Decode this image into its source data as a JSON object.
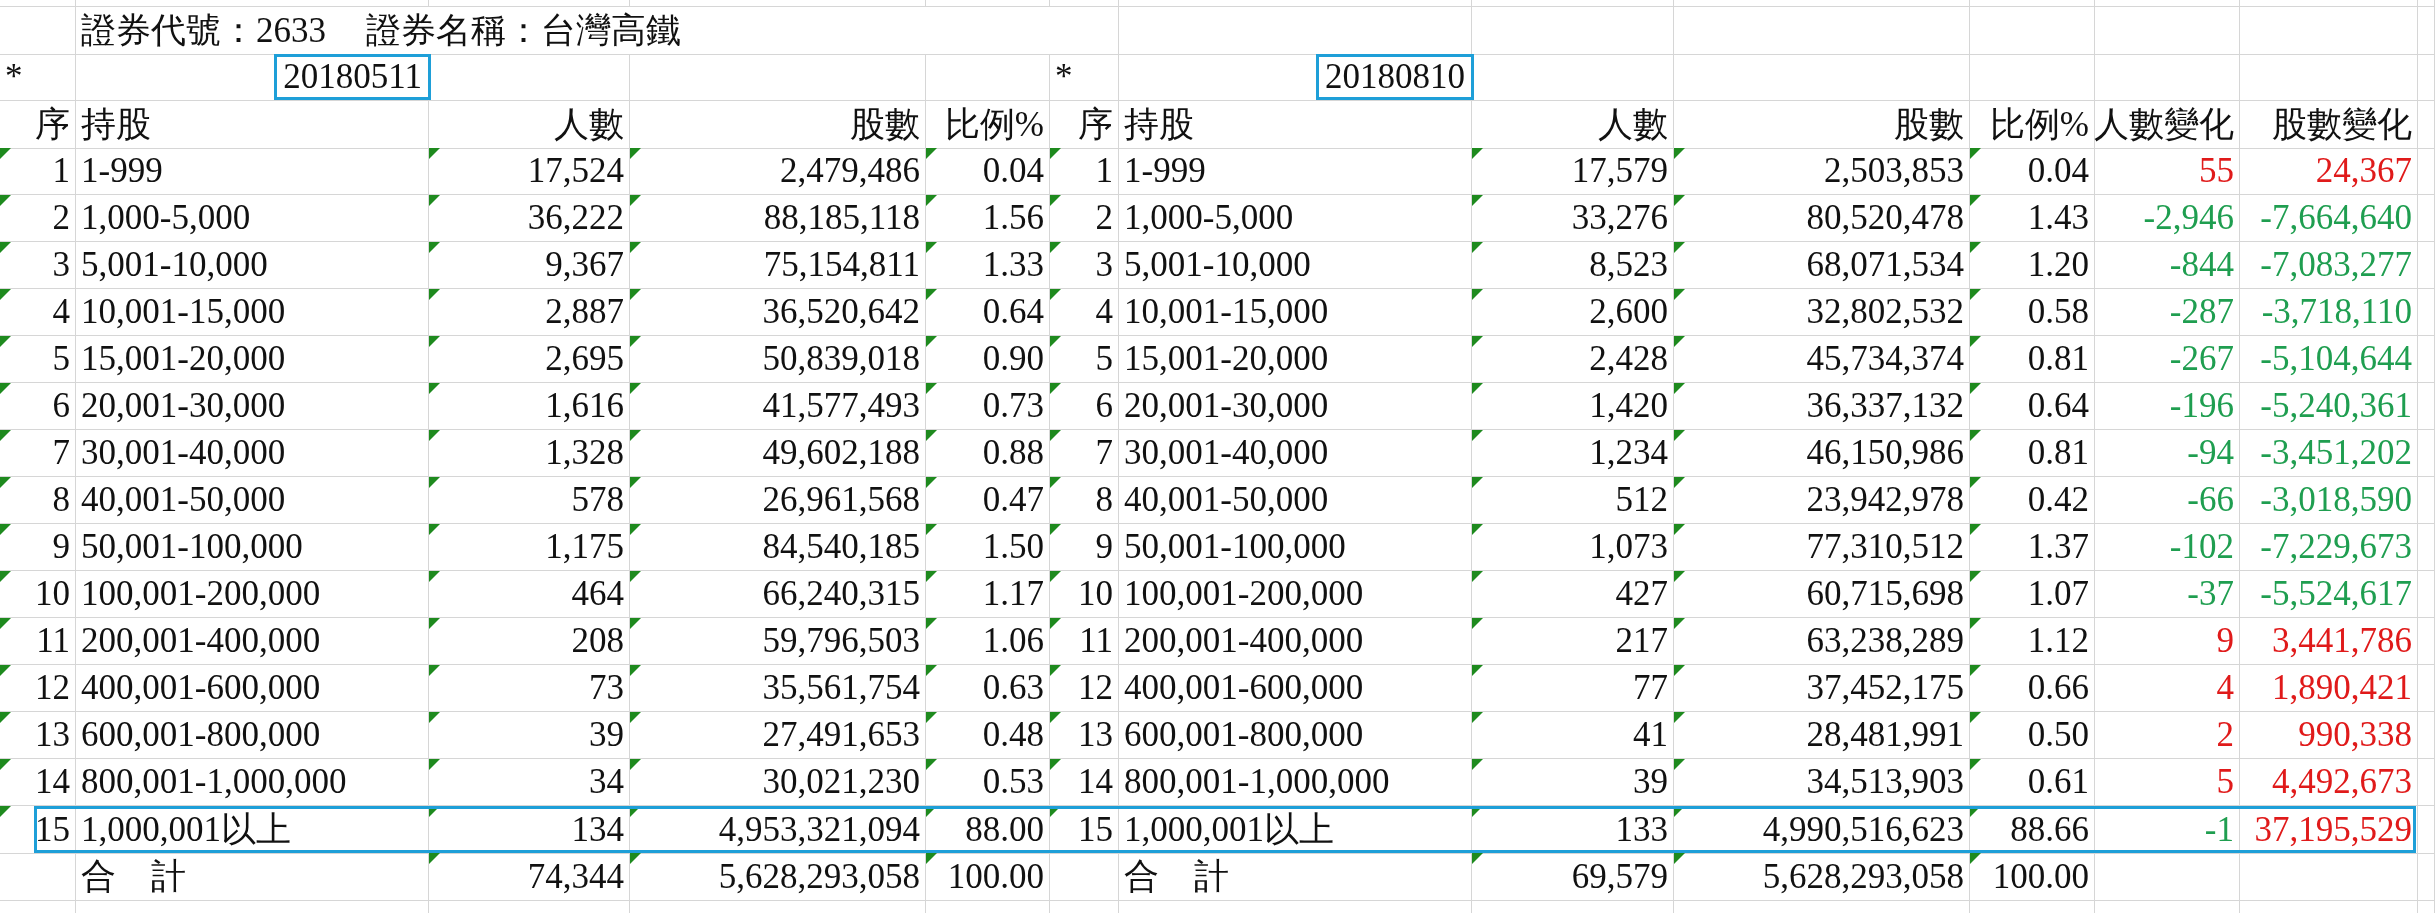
{
  "title": {
    "code": "證券代號：2633",
    "name": "證券名稱：台灣高鐵"
  },
  "periods": [
    {
      "marker": "*",
      "date": "20180511",
      "highlighted": true
    },
    {
      "marker": "*",
      "date": "20180810",
      "highlighted": true
    }
  ],
  "columns": {
    "left": [
      "序",
      "持股",
      "人數",
      "股數",
      "比例%"
    ],
    "right": [
      "序",
      "持股",
      "人數",
      "股數",
      "比例%"
    ],
    "change": [
      "人數變化",
      "股數變化"
    ]
  },
  "rows": [
    {
      "left": {
        "seq": "1",
        "range": "1-999",
        "people": "17,524",
        "shares": "2,479,486",
        "pct": "0.04"
      },
      "right": {
        "seq": "1",
        "range": "1-999",
        "people": "17,579",
        "shares": "2,503,853",
        "pct": "0.04"
      },
      "change": [
        {
          "text": "55",
          "color": "#e01a1a"
        },
        {
          "text": "24,367",
          "color": "#e01a1a"
        }
      ],
      "warning": true,
      "highlighted": false
    },
    {
      "left": {
        "seq": "2",
        "range": "1,000-5,000",
        "people": "36,222",
        "shares": "88,185,118",
        "pct": "1.56"
      },
      "right": {
        "seq": "2",
        "range": "1,000-5,000",
        "people": "33,276",
        "shares": "80,520,478",
        "pct": "1.43"
      },
      "change": [
        {
          "text": "-2,946",
          "color": "#1f9e50"
        },
        {
          "text": "-7,664,640",
          "color": "#1f9e50"
        }
      ],
      "warning": true,
      "highlighted": false
    },
    {
      "left": {
        "seq": "3",
        "range": "5,001-10,000",
        "people": "9,367",
        "shares": "75,154,811",
        "pct": "1.33"
      },
      "right": {
        "seq": "3",
        "range": "5,001-10,000",
        "people": "8,523",
        "shares": "68,071,534",
        "pct": "1.20"
      },
      "change": [
        {
          "text": "-844",
          "color": "#1f9e50"
        },
        {
          "text": "-7,083,277",
          "color": "#1f9e50"
        }
      ],
      "warning": true,
      "highlighted": false
    },
    {
      "left": {
        "seq": "4",
        "range": "10,001-15,000",
        "people": "2,887",
        "shares": "36,520,642",
        "pct": "0.64"
      },
      "right": {
        "seq": "4",
        "range": "10,001-15,000",
        "people": "2,600",
        "shares": "32,802,532",
        "pct": "0.58"
      },
      "change": [
        {
          "text": "-287",
          "color": "#1f9e50"
        },
        {
          "text": "-3,718,110",
          "color": "#1f9e50"
        }
      ],
      "warning": true,
      "highlighted": false
    },
    {
      "left": {
        "seq": "5",
        "range": "15,001-20,000",
        "people": "2,695",
        "shares": "50,839,018",
        "pct": "0.90"
      },
      "right": {
        "seq": "5",
        "range": "15,001-20,000",
        "people": "2,428",
        "shares": "45,734,374",
        "pct": "0.81"
      },
      "change": [
        {
          "text": "-267",
          "color": "#1f9e50"
        },
        {
          "text": "-5,104,644",
          "color": "#1f9e50"
        }
      ],
      "warning": true,
      "highlighted": false
    },
    {
      "left": {
        "seq": "6",
        "range": "20,001-30,000",
        "people": "1,616",
        "shares": "41,577,493",
        "pct": "0.73"
      },
      "right": {
        "seq": "6",
        "range": "20,001-30,000",
        "people": "1,420",
        "shares": "36,337,132",
        "pct": "0.64"
      },
      "change": [
        {
          "text": "-196",
          "color": "#1f9e50"
        },
        {
          "text": "-5,240,361",
          "color": "#1f9e50"
        }
      ],
      "warning": true,
      "highlighted": false
    },
    {
      "left": {
        "seq": "7",
        "range": "30,001-40,000",
        "people": "1,328",
        "shares": "49,602,188",
        "pct": "0.88"
      },
      "right": {
        "seq": "7",
        "range": "30,001-40,000",
        "people": "1,234",
        "shares": "46,150,986",
        "pct": "0.81"
      },
      "change": [
        {
          "text": "-94",
          "color": "#1f9e50"
        },
        {
          "text": "-3,451,202",
          "color": "#1f9e50"
        }
      ],
      "warning": true,
      "highlighted": false
    },
    {
      "left": {
        "seq": "8",
        "range": "40,001-50,000",
        "people": "578",
        "shares": "26,961,568",
        "pct": "0.47"
      },
      "right": {
        "seq": "8",
        "range": "40,001-50,000",
        "people": "512",
        "shares": "23,942,978",
        "pct": "0.42"
      },
      "change": [
        {
          "text": "-66",
          "color": "#1f9e50"
        },
        {
          "text": "-3,018,590",
          "color": "#1f9e50"
        }
      ],
      "warning": true,
      "highlighted": false
    },
    {
      "left": {
        "seq": "9",
        "range": "50,001-100,000",
        "people": "1,175",
        "shares": "84,540,185",
        "pct": "1.50"
      },
      "right": {
        "seq": "9",
        "range": "50,001-100,000",
        "people": "1,073",
        "shares": "77,310,512",
        "pct": "1.37"
      },
      "change": [
        {
          "text": "-102",
          "color": "#1f9e50"
        },
        {
          "text": "-7,229,673",
          "color": "#1f9e50"
        }
      ],
      "warning": true,
      "highlighted": false
    },
    {
      "left": {
        "seq": "10",
        "range": "100,001-200,000",
        "people": "464",
        "shares": "66,240,315",
        "pct": "1.17"
      },
      "right": {
        "seq": "10",
        "range": "100,001-200,000",
        "people": "427",
        "shares": "60,715,698",
        "pct": "1.07"
      },
      "change": [
        {
          "text": "-37",
          "color": "#1f9e50"
        },
        {
          "text": "-5,524,617",
          "color": "#1f9e50"
        }
      ],
      "warning": true,
      "highlighted": false
    },
    {
      "left": {
        "seq": "11",
        "range": "200,001-400,000",
        "people": "208",
        "shares": "59,796,503",
        "pct": "1.06"
      },
      "right": {
        "seq": "11",
        "range": "200,001-400,000",
        "people": "217",
        "shares": "63,238,289",
        "pct": "1.12"
      },
      "change": [
        {
          "text": "9",
          "color": "#e01a1a"
        },
        {
          "text": "3,441,786",
          "color": "#e01a1a"
        }
      ],
      "warning": true,
      "highlighted": false
    },
    {
      "left": {
        "seq": "12",
        "range": "400,001-600,000",
        "people": "73",
        "shares": "35,561,754",
        "pct": "0.63"
      },
      "right": {
        "seq": "12",
        "range": "400,001-600,000",
        "people": "77",
        "shares": "37,452,175",
        "pct": "0.66"
      },
      "change": [
        {
          "text": "4",
          "color": "#e01a1a"
        },
        {
          "text": "1,890,421",
          "color": "#e01a1a"
        }
      ],
      "warning": true,
      "highlighted": false
    },
    {
      "left": {
        "seq": "13",
        "range": "600,001-800,000",
        "people": "39",
        "shares": "27,491,653",
        "pct": "0.48"
      },
      "right": {
        "seq": "13",
        "range": "600,001-800,000",
        "people": "41",
        "shares": "28,481,991",
        "pct": "0.50"
      },
      "change": [
        {
          "text": "2",
          "color": "#e01a1a"
        },
        {
          "text": "990,338",
          "color": "#e01a1a"
        }
      ],
      "warning": true,
      "highlighted": false
    },
    {
      "left": {
        "seq": "14",
        "range": "800,001-1,000,000",
        "people": "34",
        "shares": "30,021,230",
        "pct": "0.53"
      },
      "right": {
        "seq": "14",
        "range": "800,001-1,000,000",
        "people": "39",
        "shares": "34,513,903",
        "pct": "0.61"
      },
      "change": [
        {
          "text": "5",
          "color": "#e01a1a"
        },
        {
          "text": "4,492,673",
          "color": "#e01a1a"
        }
      ],
      "warning": true,
      "highlighted": false
    },
    {
      "left": {
        "seq": "15",
        "range": "1,000,001以上",
        "people": "134",
        "shares": "4,953,321,094",
        "pct": "88.00"
      },
      "right": {
        "seq": "15",
        "range": "1,000,001以上",
        "people": "133",
        "shares": "4,990,516,623",
        "pct": "88.66"
      },
      "change": [
        {
          "text": "-1",
          "color": "#1f9e50"
        },
        {
          "text": "37,195,529",
          "color": "#e01a1a"
        }
      ],
      "warning": true,
      "highlighted": true
    }
  ],
  "total": {
    "left": {
      "label": "合　計",
      "people": "74,344",
      "shares": "5,628,293,058",
      "pct": "100.00"
    },
    "right": {
      "label": "合　計",
      "people": "69,579",
      "shares": "5,628,293,058",
      "pct": "100.00"
    },
    "warning": true
  }
}
